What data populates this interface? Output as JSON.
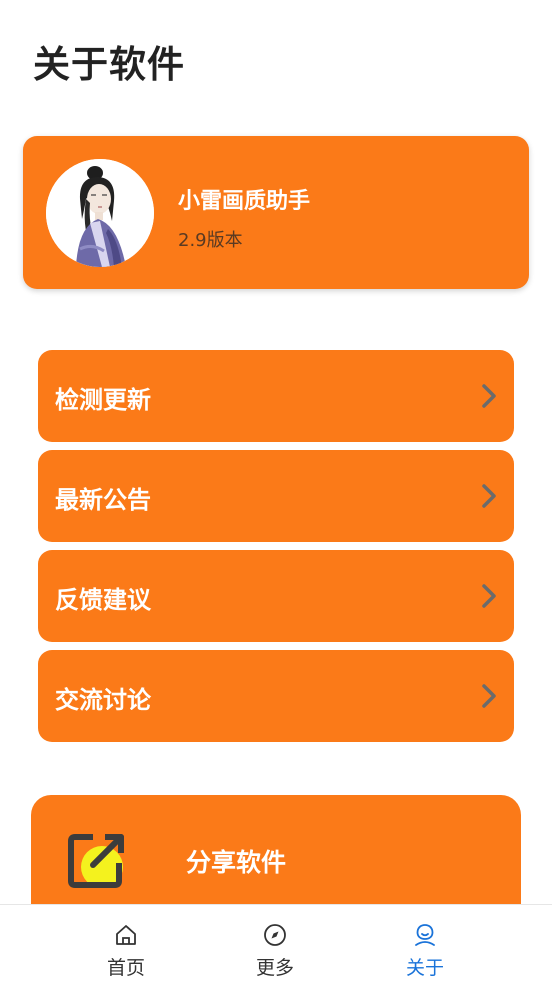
{
  "page": {
    "title": "关于软件"
  },
  "app": {
    "name": "小雷画质助手",
    "version": "2.9版本",
    "avatar_icon": "avatar-portrait"
  },
  "menu": [
    {
      "label": "检测更新",
      "icon": "chevron-right-icon"
    },
    {
      "label": "最新公告",
      "icon": "chevron-right-icon"
    },
    {
      "label": "反馈建议",
      "icon": "chevron-right-icon"
    },
    {
      "label": "交流讨论",
      "icon": "chevron-right-icon"
    }
  ],
  "share": {
    "label": "分享软件",
    "icon": "share-icon"
  },
  "tabbar": {
    "tabs": [
      {
        "label": "首页",
        "icon": "home-icon",
        "active": false
      },
      {
        "label": "更多",
        "icon": "compass-icon",
        "active": false
      },
      {
        "label": "关于",
        "icon": "user-icon",
        "active": true
      }
    ]
  },
  "colors": {
    "accent": "#fb7a18",
    "active_tab": "#1a73d9",
    "text_dark": "#222222",
    "chevron": "#6b6b6b"
  }
}
